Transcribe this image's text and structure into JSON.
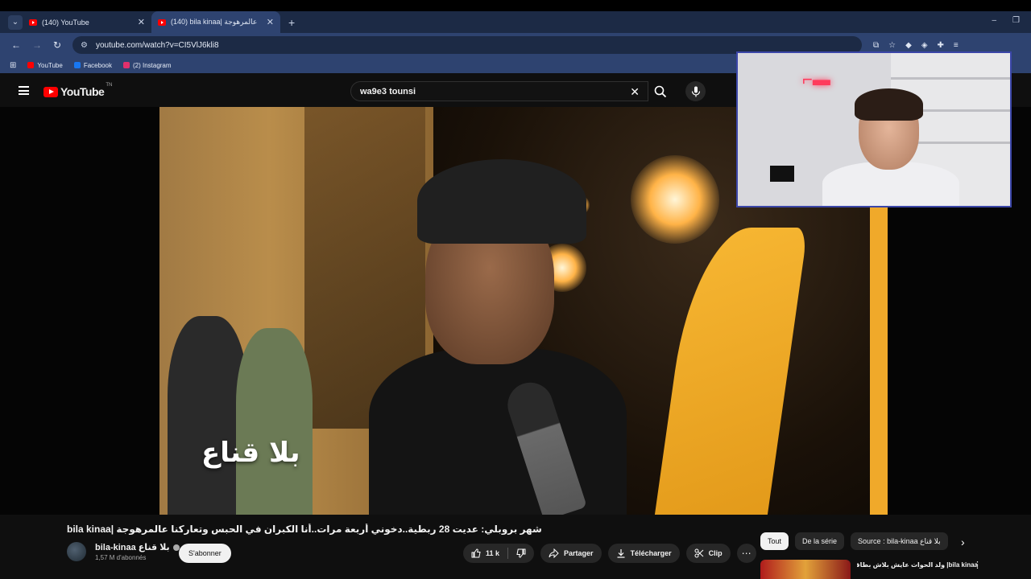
{
  "browser": {
    "tabs": [
      {
        "title": "(140) YouTube"
      },
      {
        "title": "(140) bila kinaa| عالمرهوجة"
      }
    ],
    "url": "youtube.com/watch?v=CI5VlJ6kli8",
    "bookmarks": [
      {
        "label": "YouTube",
        "icon": "youtube-icon",
        "color": "#ff0000"
      },
      {
        "label": "Facebook",
        "icon": "facebook-icon",
        "color": "#1877f2"
      },
      {
        "label": "(2) Instagram",
        "icon": "instagram-icon",
        "color": "#e1306c"
      }
    ]
  },
  "youtube": {
    "logo_text": "YouTube",
    "logo_region": "TN",
    "search_query": "wa9e3 tounsi"
  },
  "video": {
    "overlay_text": "بلا قناع",
    "title": "شهر بروبلي: عديت 28 ربطية..دخوني أربعة مرات..أنا الكبران في الحبس وتعاركنا عالمرهوجة |bila kinaa"
  },
  "channel": {
    "name": "bila-kinaa بلا قناع",
    "subscribers": "1,57 M d'abonnés",
    "subscribe_label": "S'abonner"
  },
  "actions": {
    "likes": "11 k",
    "share": "Partager",
    "download": "Télécharger",
    "clip": "Clip"
  },
  "chips": [
    "Tout",
    "De la série",
    "Source : bila-kinaa بلا قناع"
  ],
  "recommendation": {
    "title": "bila kinaa| ولد الحوات عايش بلاش بطاقة"
  },
  "colors": {
    "accent": "#ff0000",
    "background": "#0f0f0f",
    "browser_frame": "#2e4370"
  }
}
